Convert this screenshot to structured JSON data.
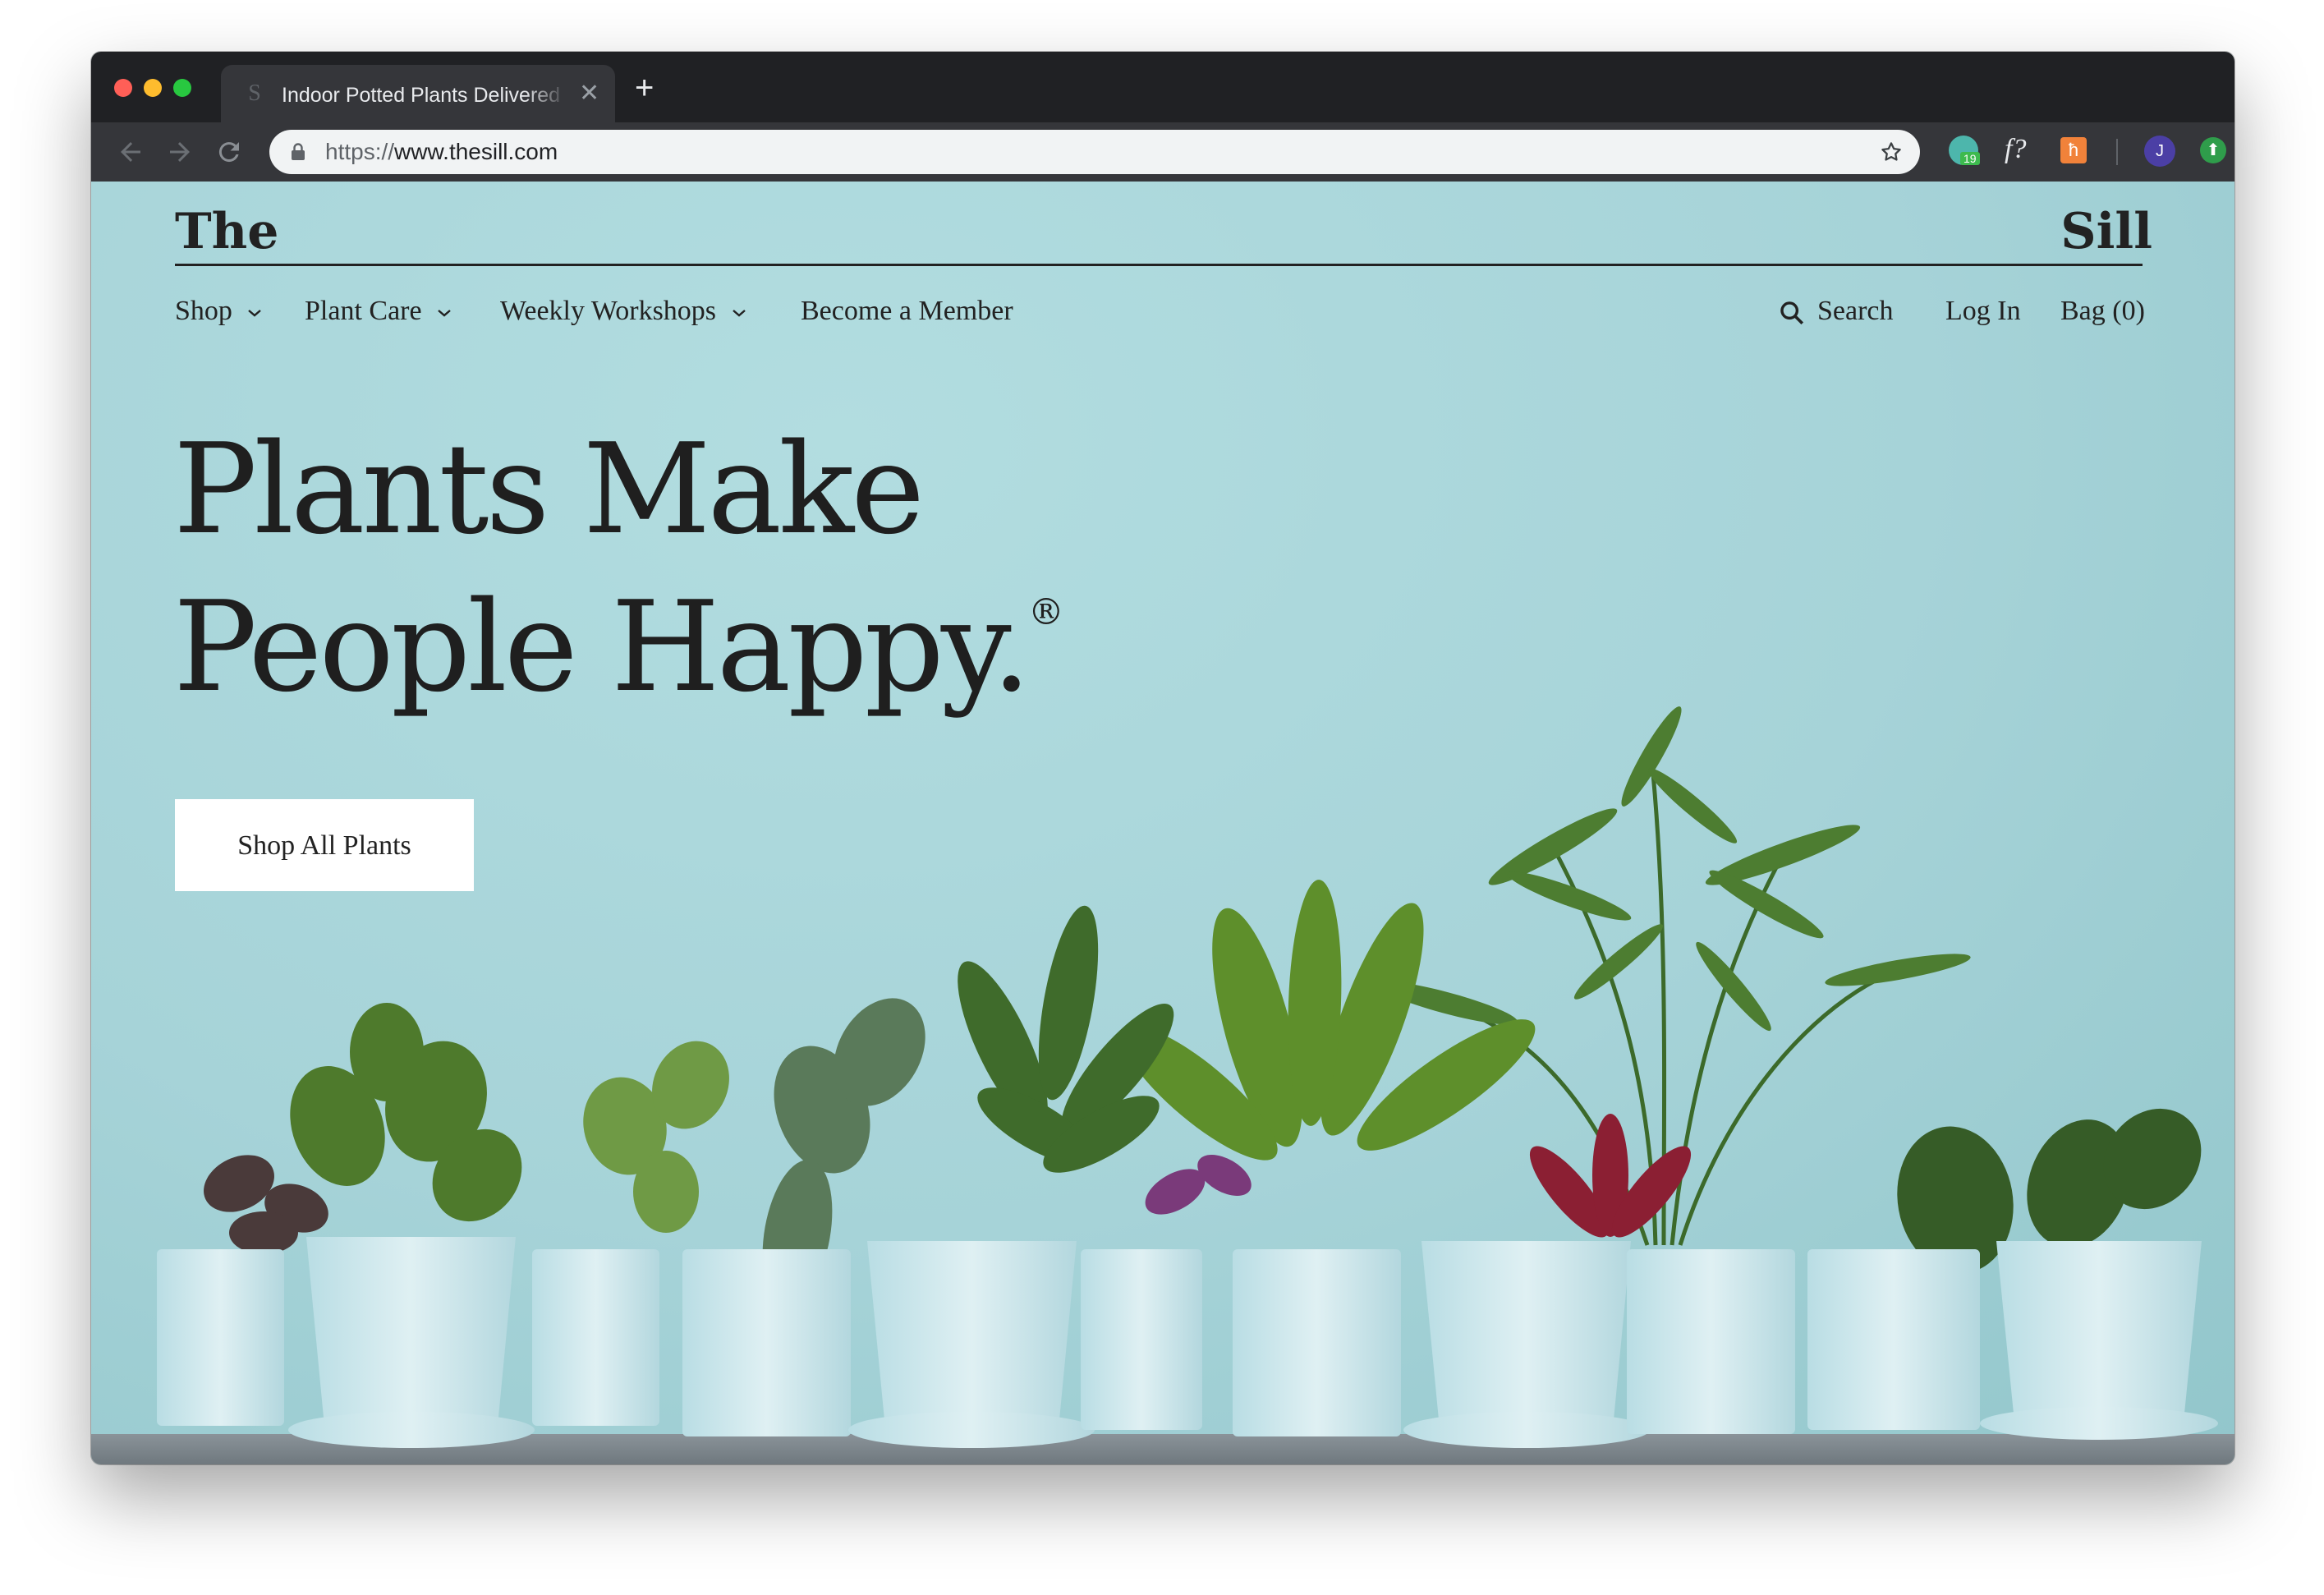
{
  "browser": {
    "tab_title": "Indoor Potted Plants Delivered",
    "favicon_letter": "S",
    "url_scheme": "https://",
    "url_host": "www.thesill.com",
    "new_tab_symbol": "+",
    "close_symbol": "✕",
    "extensions": {
      "badge_count": "19",
      "f_label": "f?",
      "h_label": "ћ",
      "avatar_initial": "J",
      "update_symbol": "⬆"
    }
  },
  "site": {
    "logo_left": "The",
    "logo_right": "Sill",
    "nav_left": [
      {
        "label": "Shop"
      },
      {
        "label": "Plant Care"
      },
      {
        "label": "Weekly Workshops"
      },
      {
        "label": "Become a Member"
      }
    ],
    "nav_right": {
      "search": "Search",
      "login": "Log In",
      "bag": "Bag (0)"
    },
    "hero": {
      "headline_line1": "Plants Make",
      "headline_line2": "People Happy.",
      "registered_mark": "®",
      "cta": "Shop All Plants"
    }
  },
  "colors": {
    "background": "#a9d6da",
    "pot": "#cde7ec",
    "text": "#222222"
  }
}
